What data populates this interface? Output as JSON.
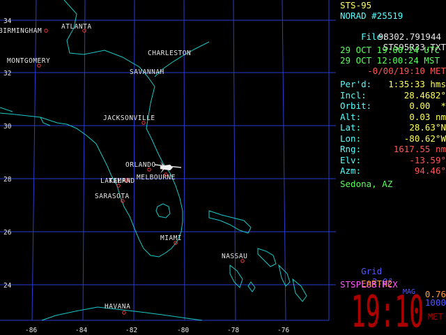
{
  "map": {
    "lat_ticks": [
      "34",
      "32",
      "30",
      "28",
      "26",
      "24"
    ],
    "lon_ticks": [
      "-86",
      "-84",
      "-82",
      "-80",
      "-78",
      "-76"
    ],
    "cities": [
      {
        "name": "BIRMINGHAM"
      },
      {
        "name": "ATLANTA"
      },
      {
        "name": "MONTGOMERY"
      },
      {
        "name": "CHARLESTON"
      },
      {
        "name": "SAVANNAH"
      },
      {
        "name": "JACKSONVILLE"
      },
      {
        "name": "ORLANDO"
      },
      {
        "name": "MELBOURNE"
      },
      {
        "name": "LAKELAND"
      },
      {
        "name": "TAMPA"
      },
      {
        "name": "SARASOTA"
      },
      {
        "name": "MIAMI"
      },
      {
        "name": "NASSAU"
      },
      {
        "name": "HAVANA"
      }
    ]
  },
  "panel": {
    "title": "STS-95",
    "norad": "NORAD #25519",
    "file_label": "File:",
    "file_value": "STS95R33.TXT",
    "epoch": "98302.791944",
    "utc": "29 OCT 19:00:24 UTC",
    "mst": "29 OCT 12:00:24 MST",
    "met": "-0/00/19:10 MET",
    "rows": [
      {
        "label": "Per'd:",
        "value": "1:35:33 hms",
        "color": "#ffff55"
      },
      {
        "label": "Incl:",
        "value": "28.4682°",
        "color": "#ffff55"
      },
      {
        "label": "Orbit:",
        "value": "0.00  *",
        "color": "#ffff55"
      },
      {
        "label": "Alt:",
        "value": "0.03 nm",
        "color": "#ffff55"
      },
      {
        "label": "Lat:",
        "value": "28.63°N",
        "color": "#ffff55"
      },
      {
        "label": "Lon:",
        "value": "-80.62°W",
        "color": "#ffff55"
      },
      {
        "label": "Rng:",
        "value": "1617.55 nm",
        "color": "#ff5555"
      },
      {
        "label": "Elv:",
        "value": "-13.59°",
        "color": "#ff5555"
      },
      {
        "label": "Azm:",
        "value": "94.46°",
        "color": "#ff5555"
      }
    ],
    "site": "Sedona, AZ",
    "grid_label": "Grid",
    "grid_value": "2.0°",
    "mag_label": "MAG",
    "mag_value": "1000",
    "earth_label": "EARTH2",
    "earth_value": "0.76",
    "pcx": "STSPLUS.PCX",
    "clock": "19:10",
    "clock_suffix": "MET"
  },
  "colors": {
    "label": "#55ffff",
    "yellow": "#ffff55",
    "green": "#55ff55",
    "red": "#ff5555",
    "blue": "#5555ff",
    "orange": "#ff9933",
    "magenta": "#ff55ff",
    "grid": "#2a3dd0",
    "coast": "#18c8c8",
    "clock": "#aa0000"
  }
}
